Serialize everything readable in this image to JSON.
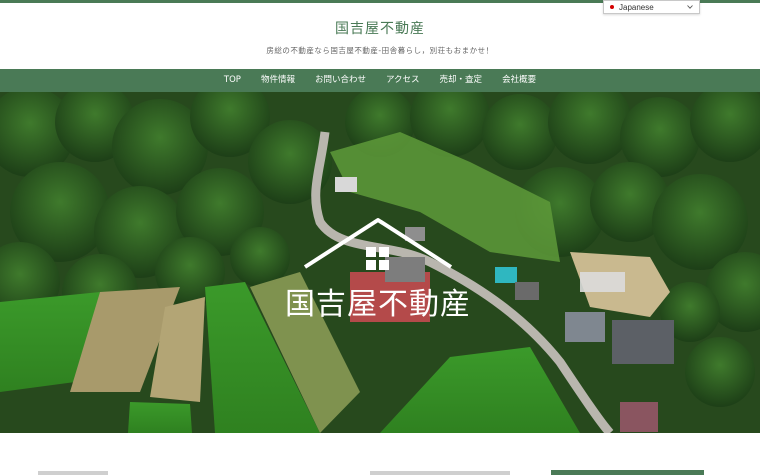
{
  "header": {
    "site_title": "国吉屋不動産",
    "tagline": "房総の不動産なら国吉屋不動産-田舎暮らし，別荘もおまかせ！"
  },
  "language": {
    "selected": "Japanese"
  },
  "nav": {
    "items": [
      {
        "label": "TOP"
      },
      {
        "label": "物件情報"
      },
      {
        "label": "お問い合わせ"
      },
      {
        "label": "アクセス"
      },
      {
        "label": "売却・査定"
      },
      {
        "label": "会社概要"
      }
    ]
  },
  "hero": {
    "logo_text": "国吉屋不動産"
  },
  "colors": {
    "brand_green": "#4a7a56",
    "nav_text": "#ffffff"
  }
}
